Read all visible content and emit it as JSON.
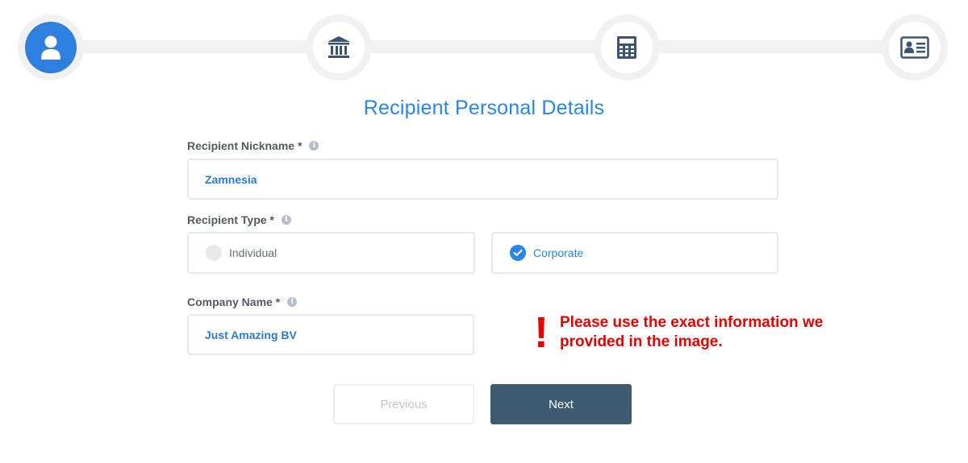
{
  "stepper": {
    "steps": [
      {
        "icon": "user-icon",
        "state": "active"
      },
      {
        "icon": "bank-icon",
        "state": "pending"
      },
      {
        "icon": "calculator-icon",
        "state": "pending"
      },
      {
        "icon": "id-card-icon",
        "state": "pending"
      }
    ]
  },
  "title": "Recipient Personal Details",
  "fields": {
    "nickname": {
      "label": "Recipient Nickname *",
      "value": "Zamnesia"
    },
    "recipient_type": {
      "label": "Recipient Type *",
      "options": [
        {
          "label": "Individual",
          "selected": false
        },
        {
          "label": "Corporate",
          "selected": true
        }
      ]
    },
    "company_name": {
      "label": "Company Name *",
      "value": "Just Amazing BV"
    }
  },
  "info_icon_glyph": "i",
  "warning": {
    "mark": "!",
    "text": "Please use the exact information we provided in the image.",
    "color": "#e50000"
  },
  "buttons": {
    "previous": "Previous",
    "next": "Next"
  },
  "colors": {
    "accent": "#2a86e3",
    "next_button": "#3e5b74"
  }
}
